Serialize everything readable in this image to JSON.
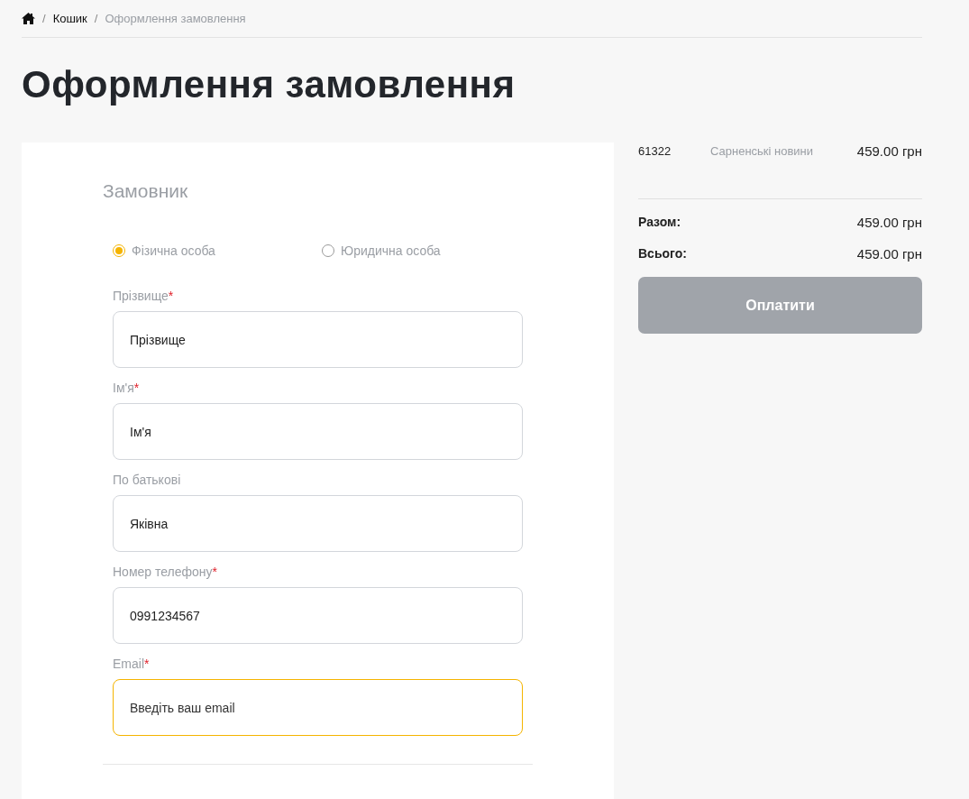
{
  "breadcrumbs": [
    {
      "separator": "/",
      "label": "Кошик",
      "current": false
    },
    {
      "separator": "/",
      "label": "Оформлення замовлення",
      "current": true
    }
  ],
  "title": "Оформлення замовлення",
  "form": {
    "heading": "Замовник",
    "customer_types": [
      {
        "label": "Фізична особа",
        "selected": true
      },
      {
        "label": "Юридична особа",
        "selected": false
      }
    ],
    "fields": [
      {
        "label": "Прізвище",
        "required_mark": "*",
        "value": "Прізвище",
        "focused": false
      },
      {
        "label": "Ім'я",
        "required_mark": "*",
        "value": "Ім'я",
        "focused": false
      },
      {
        "label": "По батькові",
        "value": "Яківна",
        "focused": false
      },
      {
        "label": "Номер телефону",
        "required_mark": "*",
        "value": "0991234567",
        "focused": false
      },
      {
        "label": "Email",
        "required_mark": "*",
        "placeholder": "Введіть ваш email",
        "focused": true
      }
    ]
  },
  "summary": {
    "items": [
      {
        "code": "61322",
        "name": "Сарненські новини",
        "price": "459.00 грн"
      }
    ],
    "totals": [
      {
        "label": "Разом:",
        "value": "459.00 грн"
      },
      {
        "label": "Всього:",
        "value": "459.00 грн"
      }
    ],
    "pay_button": "Оплатити"
  }
}
